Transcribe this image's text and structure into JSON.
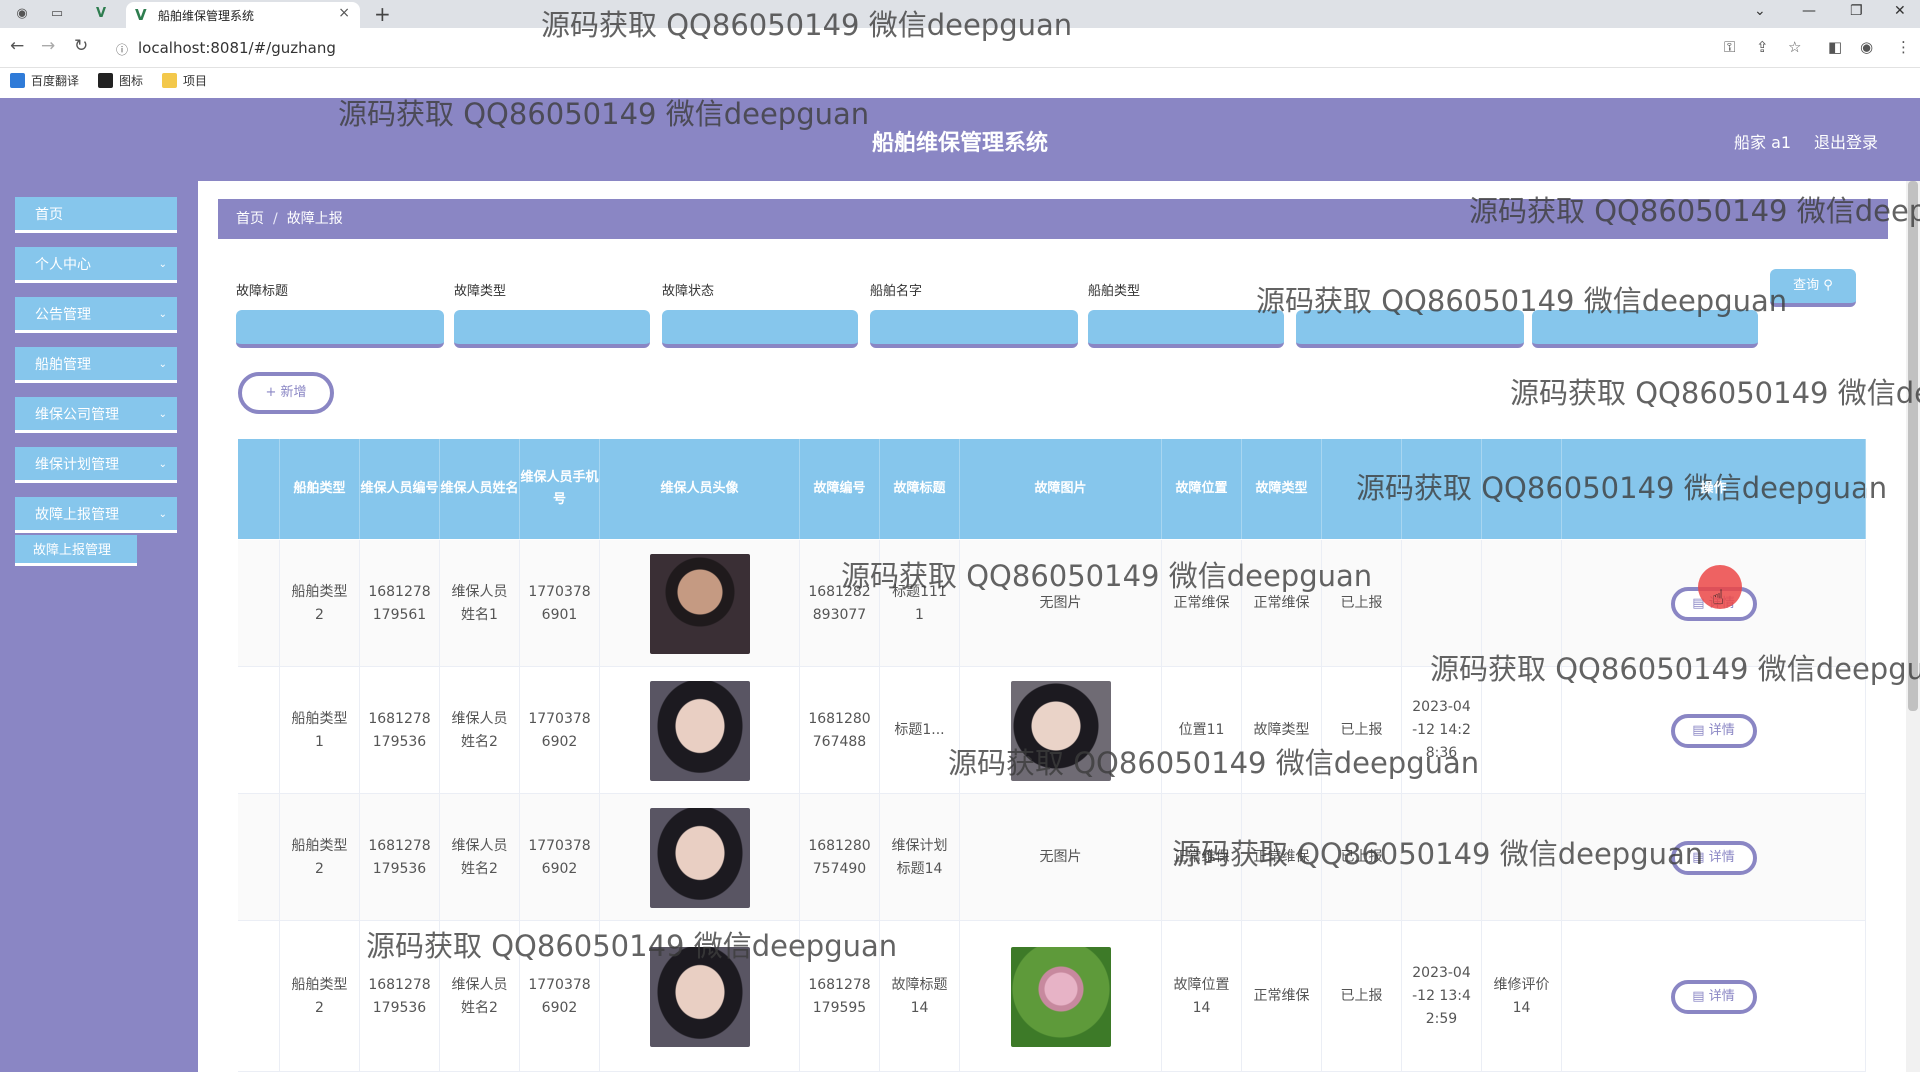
{
  "browser": {
    "tab_title": "船舶维保管理系统",
    "url": "localhost:8081/#/guzhang",
    "bookmarks": [
      "百度翻译",
      "图标",
      "项目"
    ]
  },
  "app": {
    "title": "船舶维保管理系统",
    "user": "船家 a1",
    "logout": "退出登录"
  },
  "sidebar": {
    "items": [
      {
        "label": "首页",
        "has_chevron": false
      },
      {
        "label": "个人中心",
        "has_chevron": true
      },
      {
        "label": "公告管理",
        "has_chevron": true
      },
      {
        "label": "船舶管理",
        "has_chevron": true
      },
      {
        "label": "维保公司管理",
        "has_chevron": true
      },
      {
        "label": "维保计划管理",
        "has_chevron": true
      },
      {
        "label": "故障上报管理",
        "has_chevron": true
      }
    ],
    "sub_item": "故障上报管理"
  },
  "breadcrumb": {
    "home": "首页",
    "sep": "/",
    "current": "故障上报"
  },
  "filters": [
    {
      "label": "故障标题"
    },
    {
      "label": "故障类型"
    },
    {
      "label": "故障状态"
    },
    {
      "label": "船舶名字"
    },
    {
      "label": "船舶类型"
    },
    {
      "label": ""
    },
    {
      "label": ""
    }
  ],
  "buttons": {
    "query": "查询 ⚲",
    "add": "+ 新增",
    "detail": "▤ 详情"
  },
  "table": {
    "headers": [
      "",
      "船舶类型",
      "维保人员编号",
      "维保人员姓名",
      "维保人员手机号",
      "维保人员头像",
      "故障编号",
      "故障标题",
      "故障图片",
      "故障位置",
      "故障类型",
      "",
      "",
      "",
      "操作"
    ],
    "rows": [
      {
        "ship_type": "船舶类型2",
        "staff_no": "1681278179561",
        "staff_name": "维保人员姓名1",
        "phone": "17703786901",
        "fault_no": "1681282893077",
        "fault_title": "标题1111",
        "fault_img": "无图片",
        "location": "正常维保",
        "fault_type": "正常维保",
        "status": "已上报",
        "time": "",
        "comment": ""
      },
      {
        "ship_type": "船舶类型1",
        "staff_no": "1681278179536",
        "staff_name": "维保人员姓名2",
        "phone": "17703786902",
        "fault_no": "1681280767488",
        "fault_title": "标题1...",
        "fault_img": "",
        "location": "位置11",
        "fault_type": "故障类型",
        "status": "已上报",
        "time": "2023-04-12 14:28:36",
        "comment": ""
      },
      {
        "ship_type": "船舶类型2",
        "staff_no": "1681278179536",
        "staff_name": "维保人员姓名2",
        "phone": "17703786902",
        "fault_no": "1681280757490",
        "fault_title": "维保计划标题14",
        "fault_img": "无图片",
        "location": "正常维保",
        "fault_type": "正常维保",
        "status": "已上报",
        "time": "",
        "comment": ""
      },
      {
        "ship_type": "船舶类型2",
        "staff_no": "1681278179536",
        "staff_name": "维保人员姓名2",
        "phone": "17703786902",
        "fault_no": "1681278179595",
        "fault_title": "故障标题14",
        "fault_img": "",
        "location": "故障位置14",
        "fault_type": "正常维保",
        "status": "已上报",
        "time": "2023-04-12 13:42:59",
        "comment": "维修评价14"
      }
    ]
  },
  "watermark": "源码获取 QQ86050149 微信deepguan"
}
